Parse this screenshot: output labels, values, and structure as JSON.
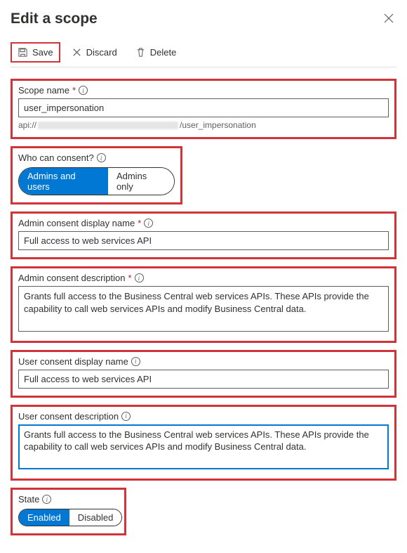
{
  "header": {
    "title": "Edit a scope"
  },
  "toolbar": {
    "save_label": "Save",
    "discard_label": "Discard",
    "delete_label": "Delete"
  },
  "scope_name": {
    "label": "Scope name",
    "value": "user_impersonation",
    "uri_prefix": "api://",
    "uri_suffix": "/user_impersonation"
  },
  "consent": {
    "label": "Who can consent?",
    "option_admins_users": "Admins and users",
    "option_admins_only": "Admins only"
  },
  "admin_display": {
    "label": "Admin consent display name",
    "value": "Full access to web services API"
  },
  "admin_desc": {
    "label": "Admin consent description",
    "value": "Grants full access to the Business Central web services APIs. These APIs provide the capability to call web services APIs and modify Business Central data."
  },
  "user_display": {
    "label": "User consent display name",
    "value": "Full access to web services API"
  },
  "user_desc": {
    "label": "User consent description",
    "value": "Grants full access to the Business Central web services APIs. These APIs provide the capability to call web services APIs and modify Business Central data."
  },
  "state": {
    "label": "State",
    "option_enabled": "Enabled",
    "option_disabled": "Disabled"
  }
}
